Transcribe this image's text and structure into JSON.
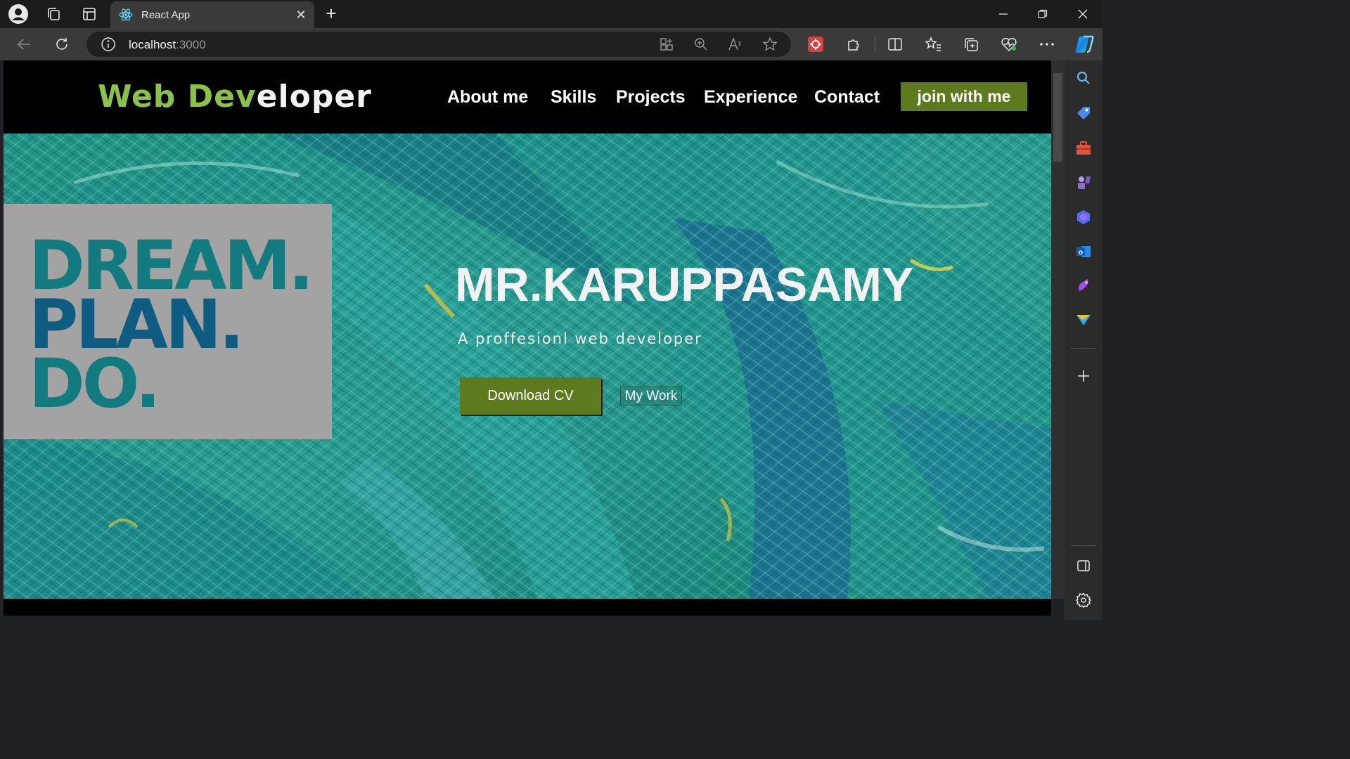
{
  "browser": {
    "tab_title": "React App",
    "url_host": "localhost",
    "url_port": ":3000"
  },
  "nav": {
    "logo_green": "Web Dev",
    "logo_white": "eloper",
    "links": [
      "About me",
      "Skills",
      "Projects",
      "Experience",
      "Contact"
    ],
    "cta_label": "join with me"
  },
  "hero": {
    "dream_lines": [
      "DREAM.",
      "PLAN.",
      "DO."
    ],
    "name": "MR.KARUPPASAMY",
    "subtitle": "A proffesionl web developer",
    "download_label": "Download CV",
    "work_label": "My Work"
  },
  "colors": {
    "accent_green": "#8bc34a",
    "button_olive": "#5d7a1f",
    "dream_teal": "#137a80",
    "plan_blue": "#0f5c82"
  },
  "icons": {
    "profile": "profile-icon",
    "workspaces": "workspaces-icon",
    "tab_actions": "tab-actions-icon",
    "back": "back-icon",
    "refresh": "refresh-icon",
    "info": "info-icon",
    "favorites": "favorites-icon",
    "extensions": "extensions-icon"
  }
}
